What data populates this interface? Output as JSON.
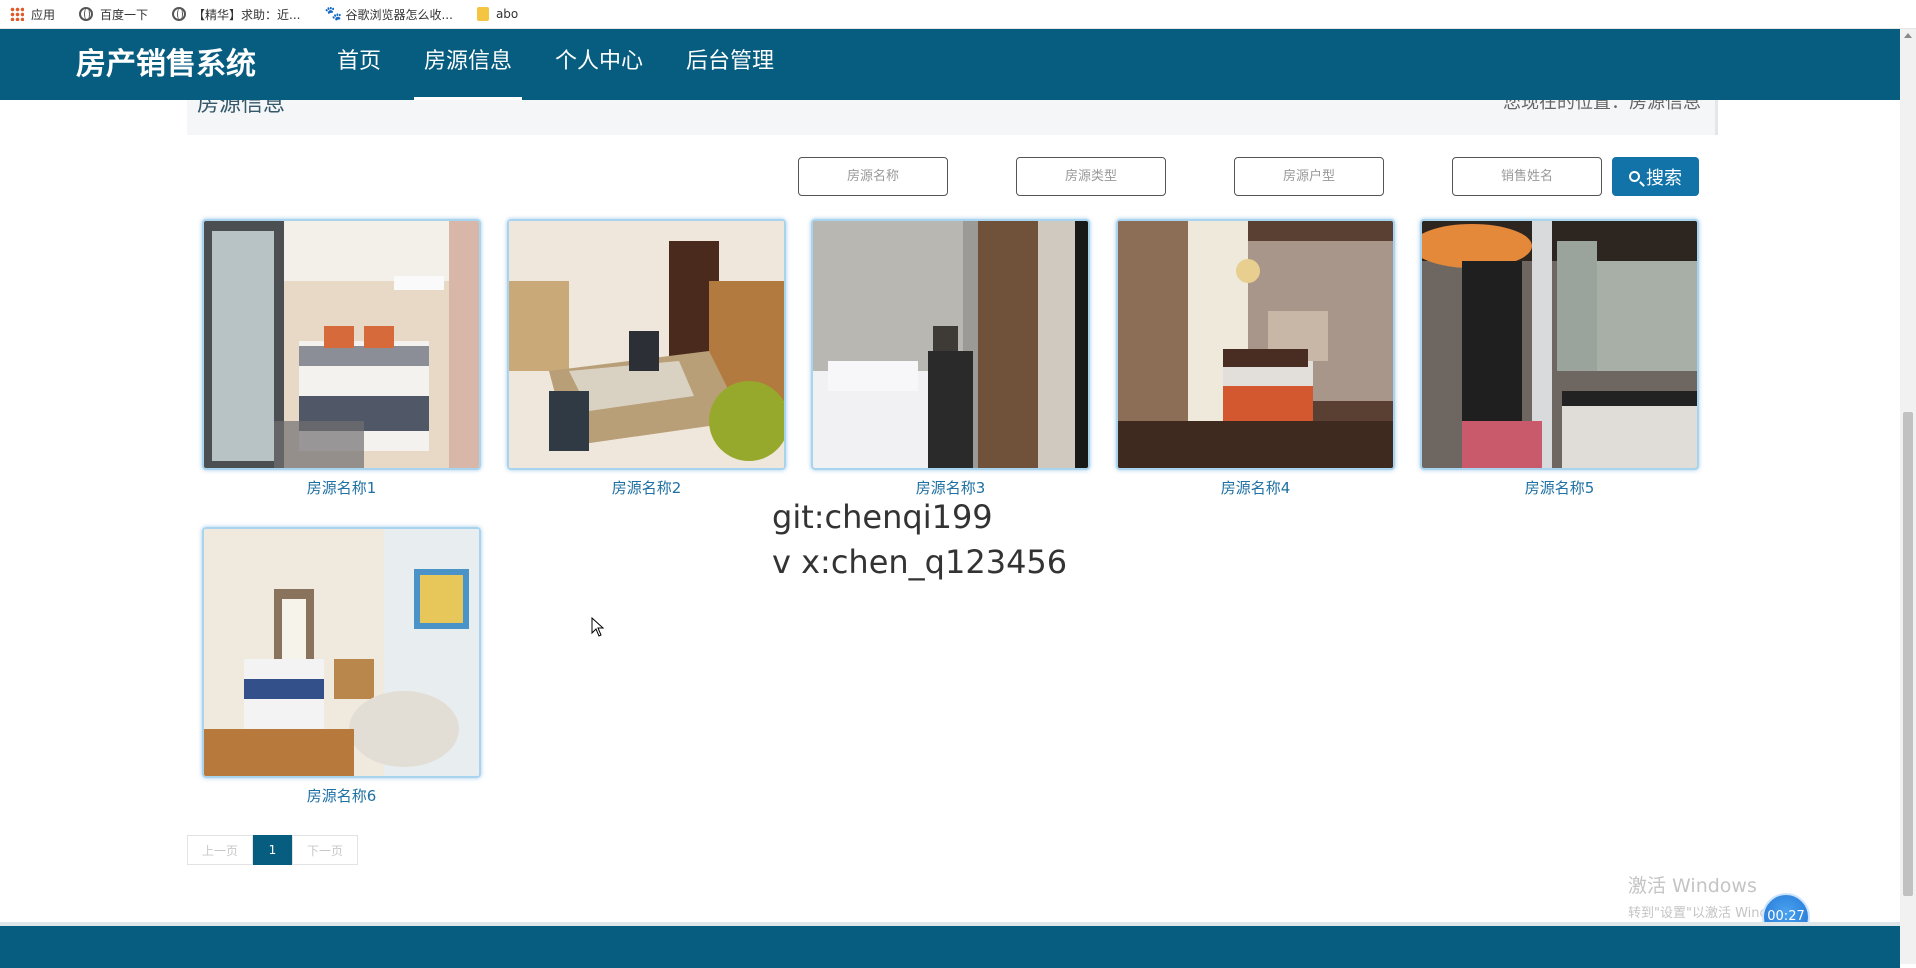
{
  "bookmarks": [
    {
      "icon": "apps-icon",
      "label": "应用"
    },
    {
      "icon": "globe-icon",
      "label": "百度一下"
    },
    {
      "icon": "globe-icon",
      "label": "【精华】求助：近..."
    },
    {
      "icon": "paw-icon",
      "label": "谷歌浏览器怎么收..."
    },
    {
      "icon": "folder-icon",
      "label": "abo"
    }
  ],
  "nav": {
    "brand": "房产销售系统",
    "items": [
      "首页",
      "房源信息",
      "个人中心",
      "后台管理"
    ],
    "active": "房源信息"
  },
  "breadcrumb": {
    "title": "房源信息",
    "location": "您现在的位置：房源信息"
  },
  "search": {
    "name_placeholder": "房源名称",
    "type_placeholder": "房源类型",
    "layout_placeholder": "房源户型",
    "sales_placeholder": "销售姓名",
    "button_label": "搜索"
  },
  "listings": [
    {
      "name": "房源名称1"
    },
    {
      "name": "房源名称2"
    },
    {
      "name": "房源名称3"
    },
    {
      "name": "房源名称4"
    },
    {
      "name": "房源名称5"
    },
    {
      "name": "房源名称6"
    }
  ],
  "overlay": {
    "line1": "git:chenqi199",
    "line2": "v x:chen_q123456"
  },
  "pagination": {
    "prev": "上一页",
    "current": "1",
    "next": "下一页"
  },
  "windows_activation": {
    "line1": "激活 Windows",
    "line2": "转到\"设置\"以激活 Windows。"
  },
  "timer": "00:27",
  "colors": {
    "primary": "#075d80",
    "button": "#1173a8",
    "link": "#1f70a3"
  }
}
